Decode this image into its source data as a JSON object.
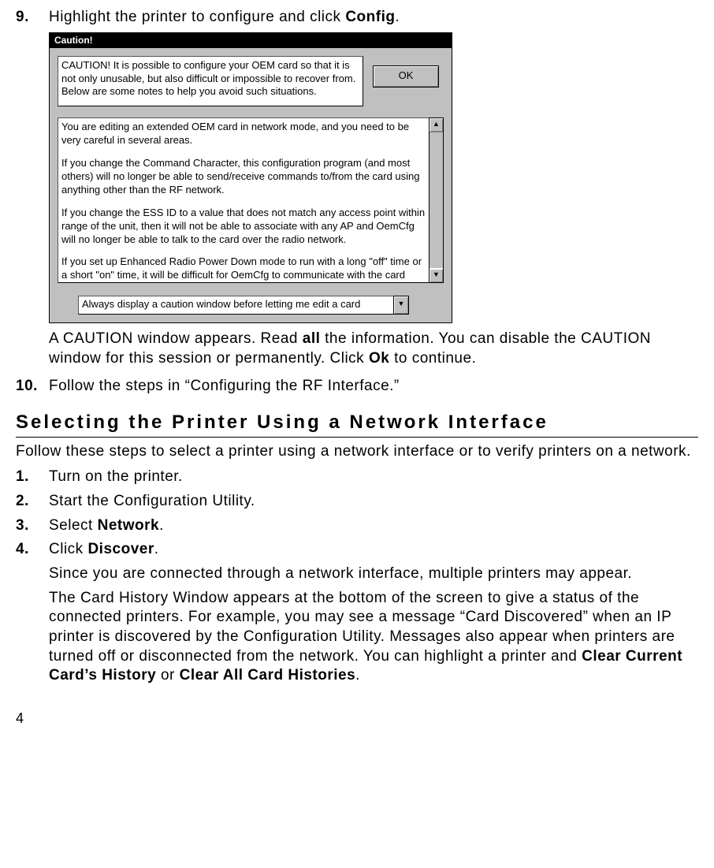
{
  "step9": {
    "num": "9.",
    "text_before": "Highlight the printer to configure and click ",
    "bold": "Config",
    "text_after": "."
  },
  "dialog": {
    "title": "Caution!",
    "caution_text": "CAUTION!  It is possible to configure your OEM card so that it is not only unusable, but also difficult or impossible to recover from. Below are some notes to help you avoid such situations.",
    "ok": "OK",
    "para1": "You are editing an extended OEM card in network mode, and you need to be very careful in several areas.",
    "para2": "If you change the Command Character, this configuration program (and most others) will no longer be able to send/receive commands to/from the card using anything other than the RF network.",
    "para3": "If you change the ESS ID to a value that does not match any access point within range of the unit, then it will not be able to associate with any AP and OemCfg will no longer be able to talk to the card over the radio network.",
    "para4": "If you set up Enhanced Radio Power Down mode to run with a long \"off\" time or a short \"on\" time, it will be difficult for OemCfg to communicate with the card again over the radio network.",
    "dropdown": "Always display a caution window before letting me edit a card"
  },
  "after9": {
    "t1": "A CAUTION window appears.  Read ",
    "b1": "all",
    "t2": " the information.  You can disable the CAUTION window for this session or permanently.  Click ",
    "b2": "Ok",
    "t3": " to continue."
  },
  "step10": {
    "num": "10.",
    "text": "Follow the steps in “Configuring the RF Interface.”"
  },
  "heading": "Selecting the Printer Using a Network Interface",
  "intro": "Follow these steps to select a printer using a network interface or to verify printers on a network.",
  "s1": {
    "num": "1.",
    "text": "Turn on the printer."
  },
  "s2": {
    "num": "2.",
    "text": "Start the Configuration Utility."
  },
  "s3": {
    "num": "3.",
    "t1": "Select ",
    "b1": "Network",
    "t2": "."
  },
  "s4": {
    "num": "4.",
    "line1_t1": "Click ",
    "line1_b1": "Discover",
    "line1_t2": ".",
    "p2": "Since you are connected through a network interface, multiple printers may appear.",
    "p3_t1": "The Card History Window appears at the bottom of the screen to give a status of the connected printers.  For example, you may see a message “Card Discovered” when an IP printer is discovered by the Configuration Utility.  Messages also appear when printers are turned off or disconnected from the network.  You can highlight a printer and ",
    "p3_b1": "Clear Current Card’s History",
    "p3_t2": " or ",
    "p3_b2": "Clear All Card Histories",
    "p3_t3": "."
  },
  "pagenum": "4"
}
